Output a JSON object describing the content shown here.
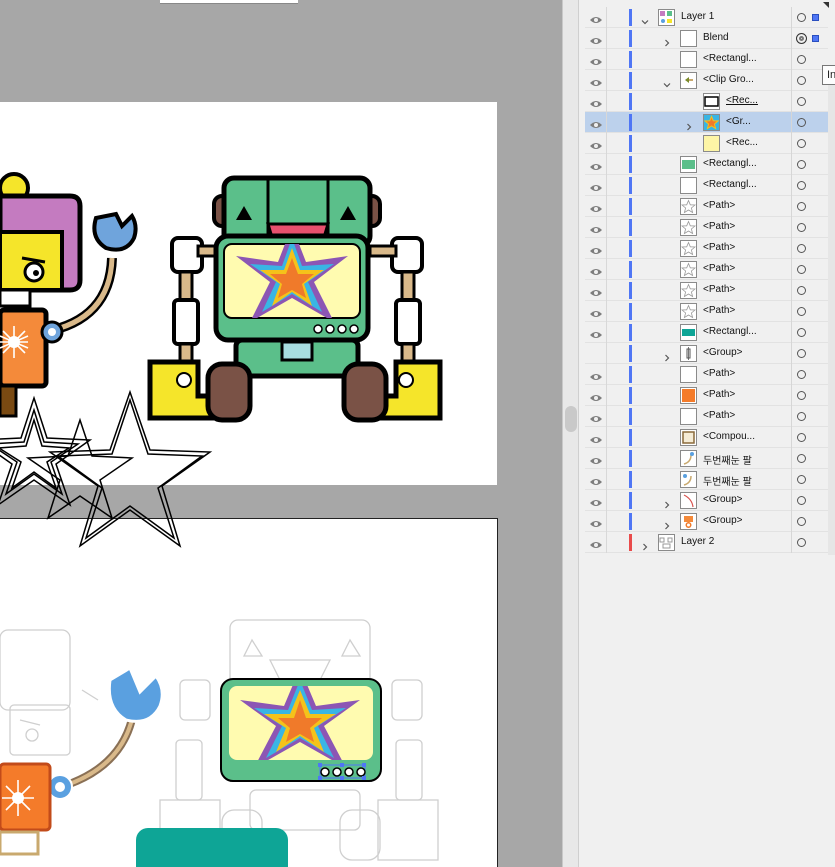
{
  "tooltip": "In",
  "layers": [
    {
      "label": "Layer 1",
      "indent": 0,
      "chevron": "down",
      "thumb": "layer-thumb",
      "eye": true,
      "selected": false,
      "bar": "#4f76f5",
      "target": "single",
      "selbox": true
    },
    {
      "label": "Blend",
      "indent": 1,
      "chevron": "right",
      "thumb": "blank",
      "eye": true,
      "selected": false,
      "bar": "#4f76f5",
      "target": "double",
      "selbox": true
    },
    {
      "label": "<Rectangl...",
      "indent": 1,
      "chevron": "",
      "thumb": "blank",
      "eye": true,
      "selected": false,
      "bar": "#4f76f5",
      "target": "single",
      "selbox": false
    },
    {
      "label": "<Clip Gro...",
      "indent": 1,
      "chevron": "down",
      "thumb": "clip-thumb",
      "eye": true,
      "selected": false,
      "bar": "#4f76f5",
      "target": "single",
      "selbox": false
    },
    {
      "label": "<Rec...",
      "indent": 2,
      "chevron": "",
      "thumb": "outline",
      "eye": true,
      "selected": false,
      "bar": "#4f76f5",
      "target": "single",
      "selbox": false,
      "underline": true
    },
    {
      "label": "<Gr...",
      "indent": 2,
      "chevron": "right",
      "thumb": "star-thumb",
      "eye": true,
      "selected": true,
      "bar": "#4f76f5",
      "target": "single",
      "selbox": false
    },
    {
      "label": "<Rec...",
      "indent": 2,
      "chevron": "",
      "thumb": "yellow",
      "eye": true,
      "selected": false,
      "bar": "#4f76f5",
      "target": "single",
      "selbox": false
    },
    {
      "label": "<Rectangl...",
      "indent": 1,
      "chevron": "",
      "thumb": "green",
      "eye": true,
      "selected": false,
      "bar": "#4f76f5",
      "target": "single",
      "selbox": false
    },
    {
      "label": "<Rectangl...",
      "indent": 1,
      "chevron": "",
      "thumb": "blank",
      "eye": true,
      "selected": false,
      "bar": "#4f76f5",
      "target": "single",
      "selbox": false
    },
    {
      "label": "<Path>",
      "indent": 1,
      "chevron": "",
      "thumb": "star-outline",
      "eye": true,
      "selected": false,
      "bar": "#4f76f5",
      "target": "single",
      "selbox": false
    },
    {
      "label": "<Path>",
      "indent": 1,
      "chevron": "",
      "thumb": "star-outline",
      "eye": true,
      "selected": false,
      "bar": "#4f76f5",
      "target": "single",
      "selbox": false
    },
    {
      "label": "<Path>",
      "indent": 1,
      "chevron": "",
      "thumb": "star-outline",
      "eye": true,
      "selected": false,
      "bar": "#4f76f5",
      "target": "single",
      "selbox": false
    },
    {
      "label": "<Path>",
      "indent": 1,
      "chevron": "",
      "thumb": "star-outline",
      "eye": true,
      "selected": false,
      "bar": "#4f76f5",
      "target": "single",
      "selbox": false
    },
    {
      "label": "<Path>",
      "indent": 1,
      "chevron": "",
      "thumb": "star-outline",
      "eye": true,
      "selected": false,
      "bar": "#4f76f5",
      "target": "single",
      "selbox": false
    },
    {
      "label": "<Path>",
      "indent": 1,
      "chevron": "",
      "thumb": "star-outline",
      "eye": true,
      "selected": false,
      "bar": "#4f76f5",
      "target": "single",
      "selbox": false
    },
    {
      "label": "<Rectangl...",
      "indent": 1,
      "chevron": "",
      "thumb": "teal",
      "eye": true,
      "selected": false,
      "bar": "#4f76f5",
      "target": "single",
      "selbox": false
    },
    {
      "label": "<Group>",
      "indent": 1,
      "chevron": "right",
      "thumb": "group-thin",
      "eye": false,
      "selected": false,
      "bar": "#4f76f5",
      "target": "single",
      "selbox": false
    },
    {
      "label": "<Path>",
      "indent": 1,
      "chevron": "",
      "thumb": "blank",
      "eye": true,
      "selected": false,
      "bar": "#4f76f5",
      "target": "single",
      "selbox": false
    },
    {
      "label": "<Path>",
      "indent": 1,
      "chevron": "",
      "thumb": "orange",
      "eye": true,
      "selected": false,
      "bar": "#4f76f5",
      "target": "single",
      "selbox": false
    },
    {
      "label": "<Path>",
      "indent": 1,
      "chevron": "",
      "thumb": "blank",
      "eye": true,
      "selected": false,
      "bar": "#4f76f5",
      "target": "single",
      "selbox": false
    },
    {
      "label": "<Compou...",
      "indent": 1,
      "chevron": "",
      "thumb": "compound",
      "eye": true,
      "selected": false,
      "bar": "#4f76f5",
      "target": "single",
      "selbox": false
    },
    {
      "label": "두번째눈 팔",
      "indent": 1,
      "chevron": "",
      "thumb": "arm1",
      "eye": true,
      "selected": false,
      "bar": "#4f76f5",
      "target": "single",
      "selbox": false
    },
    {
      "label": "두번째눈 팔",
      "indent": 1,
      "chevron": "",
      "thumb": "arm2",
      "eye": true,
      "selected": false,
      "bar": "#4f76f5",
      "target": "single",
      "selbox": false
    },
    {
      "label": "<Group>",
      "indent": 1,
      "chevron": "right",
      "thumb": "group-line",
      "eye": true,
      "selected": false,
      "bar": "#4f76f5",
      "target": "single",
      "selbox": false
    },
    {
      "label": "<Group>",
      "indent": 1,
      "chevron": "right",
      "thumb": "group-robot",
      "eye": true,
      "selected": false,
      "bar": "#4f76f5",
      "target": "single",
      "selbox": false
    },
    {
      "label": "Layer 2",
      "indent": 0,
      "chevron": "right",
      "thumb": "layer2-thumb",
      "eye": true,
      "selected": false,
      "bar": "#e94b4b",
      "target": "single",
      "selbox": false
    }
  ]
}
